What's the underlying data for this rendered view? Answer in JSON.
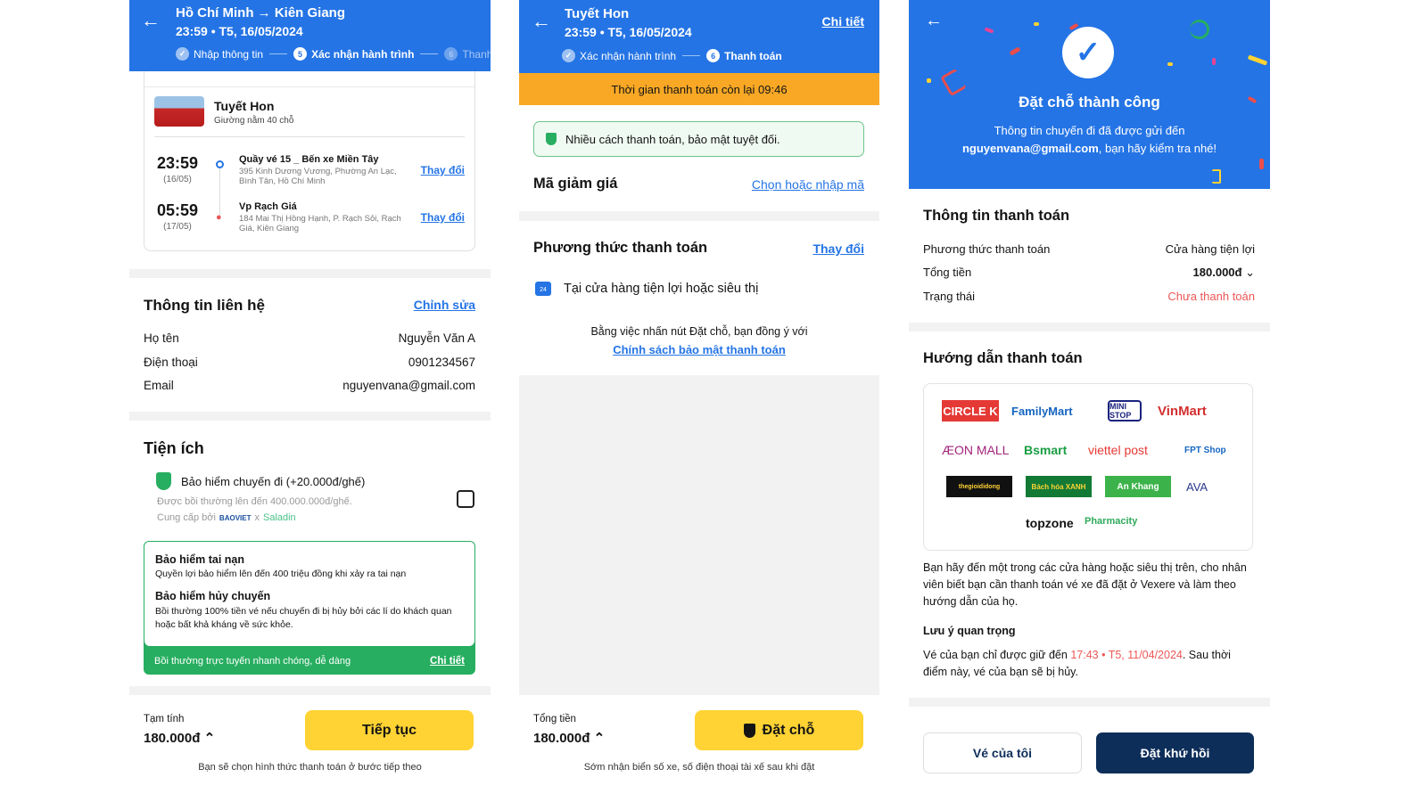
{
  "screen1": {
    "header": {
      "title": "Hồ Chí Minh → Kiên Giang",
      "subtitle": "23:59 • T5, 16/05/2024",
      "steps": [
        {
          "num": "",
          "label": "Nhập thông tin",
          "state": "done"
        },
        {
          "num": "5",
          "label": "Xác nhận hành trình",
          "state": "active"
        },
        {
          "num": "6",
          "label": "Thanh toán",
          "state": "pending"
        }
      ]
    },
    "trip": {
      "operator": "Tuyết Hon",
      "vehicle": "Giường nằm 40 chỗ",
      "stops": [
        {
          "time": "23:59",
          "date": "(16/05)",
          "name": "Quầy vé 15 _ Bến xe Miền Tây",
          "address": "395 Kinh Dương Vương, Phường An Lạc, Bình Tân, Hồ Chí Minh",
          "action": "Thay đổi"
        },
        {
          "time": "05:59",
          "date": "(17/05)",
          "name": "Vp Rạch Giá",
          "address": "184 Mai Thị Hồng Hạnh, P. Rạch Sỏi, Rạch Giá, Kiên Giang",
          "action": "Thay đổi"
        }
      ]
    },
    "contact": {
      "title": "Thông tin liên hệ",
      "edit": "Chỉnh sửa",
      "rows": [
        {
          "label": "Họ tên",
          "value": "Nguyễn Văn A"
        },
        {
          "label": "Điện thoại",
          "value": "0901234567"
        },
        {
          "label": "Email",
          "value": "nguyenvana@gmail.com"
        }
      ]
    },
    "amenities": {
      "title": "Tiện ích",
      "insurance_title": "Bảo hiểm chuyến đi (+20.000đ/ghế)",
      "insurance_desc": "Được bồi thường lên đến 400.000.000đ/ghế.",
      "provided_by": "Cung cấp bởi",
      "provider1": "BAOVIET",
      "provider_sep": "x",
      "provider2": "Saladin",
      "checked": false,
      "benefits": [
        {
          "title": "Bảo hiểm tai nạn",
          "desc": "Quyền lợi bảo hiểm lên đến 400 triệu đồng khi xảy ra tai nạn"
        },
        {
          "title": "Bảo hiểm hủy chuyến",
          "desc": "Bồi thường 100% tiền vé nếu chuyến đi bị hủy bởi các lí do khách quan hoặc bất khả kháng về sức khỏe."
        }
      ],
      "footer_text": "Bồi thường trực tuyến nhanh chóng, dễ dàng",
      "footer_link": "Chi tiết"
    },
    "footer": {
      "label": "Tạm tính",
      "price": "180.000đ",
      "button": "Tiếp tục",
      "note": "Bạn sẽ chọn hình thức thanh toán ở bước tiếp theo"
    }
  },
  "screen2": {
    "header": {
      "title": "Tuyết Hon",
      "subtitle": "23:59 • T5, 16/05/2024",
      "detail": "Chi tiết",
      "steps": [
        {
          "num": "",
          "label": "Xác nhận hành trình",
          "state": "done"
        },
        {
          "num": "6",
          "label": "Thanh toán",
          "state": "active"
        }
      ]
    },
    "timer": "Thời gian thanh toán còn lại 09:46",
    "secure_notice": "Nhiều cách thanh toán, bảo mật tuyệt đối.",
    "discount": {
      "title": "Mã giảm giá",
      "action": "Chọn hoặc nhập mã"
    },
    "payment": {
      "title": "Phương thức thanh toán",
      "action": "Thay đổi",
      "method": "Tại cửa hàng tiện lợi hoặc siêu thị"
    },
    "agree_text": "Bằng việc nhấn nút Đặt chỗ, bạn đồng ý với",
    "policy_link": "Chính sách bảo mật thanh toán",
    "footer": {
      "label": "Tổng tiền",
      "price": "180.000đ",
      "button": "Đặt chỗ",
      "note": "Sớm nhận biển số xe, số điện thoại tài xế sau khi đặt"
    }
  },
  "screen3": {
    "success": {
      "title": "Đặt chỗ thành công",
      "line1": "Thông tin chuyến đi đã được gửi đến",
      "email": "nguyenvana@gmail.com",
      "line2": ", bạn hãy kiểm tra nhé!"
    },
    "payment_info": {
      "title": "Thông tin thanh toán",
      "rows": [
        {
          "label": "Phương thức thanh toán",
          "value": "Cửa hàng tiện lợi"
        },
        {
          "label": "Tổng tiền",
          "value": "180.000đ"
        },
        {
          "label": "Trạng thái",
          "value": "Chưa thanh toán"
        }
      ]
    },
    "guide": {
      "title": "Hướng dẫn thanh toán",
      "stores": [
        "CIRCLE K",
        "FamilyMart",
        "MINI STOP",
        "VinMart",
        "ÆON MALL",
        "Bsmart",
        "viettel post",
        "FPT Shop",
        "thegioididong",
        "Bách hóa XANH",
        "An Khang",
        "AVA",
        "topzone",
        "Pharmacity"
      ],
      "text": "Bạn hãy đến một trong các cửa hàng hoặc siêu thị trên, cho nhân viên biết bạn cần thanh toán vé xe đã đặt ở Vexere và làm theo hướng dẫn của họ.",
      "note_title": "Lưu ý quan trọng",
      "note_pre": "Vé của bạn chỉ được giữ đến ",
      "note_deadline": "17:43 • T5, 11/04/2024",
      "note_post": ". Sau thời điểm này, vé của bạn sẽ bị hủy."
    },
    "buttons": {
      "my_tickets": "Vé của tôi",
      "return_trip": "Đặt khứ hồi"
    }
  },
  "colors": {
    "primary": "#2474e5",
    "accent_yellow": "#ffd333",
    "timer_orange": "#f9a825",
    "success_green": "#27ae60",
    "danger": "#eb5757",
    "navy": "#0d2e59"
  }
}
